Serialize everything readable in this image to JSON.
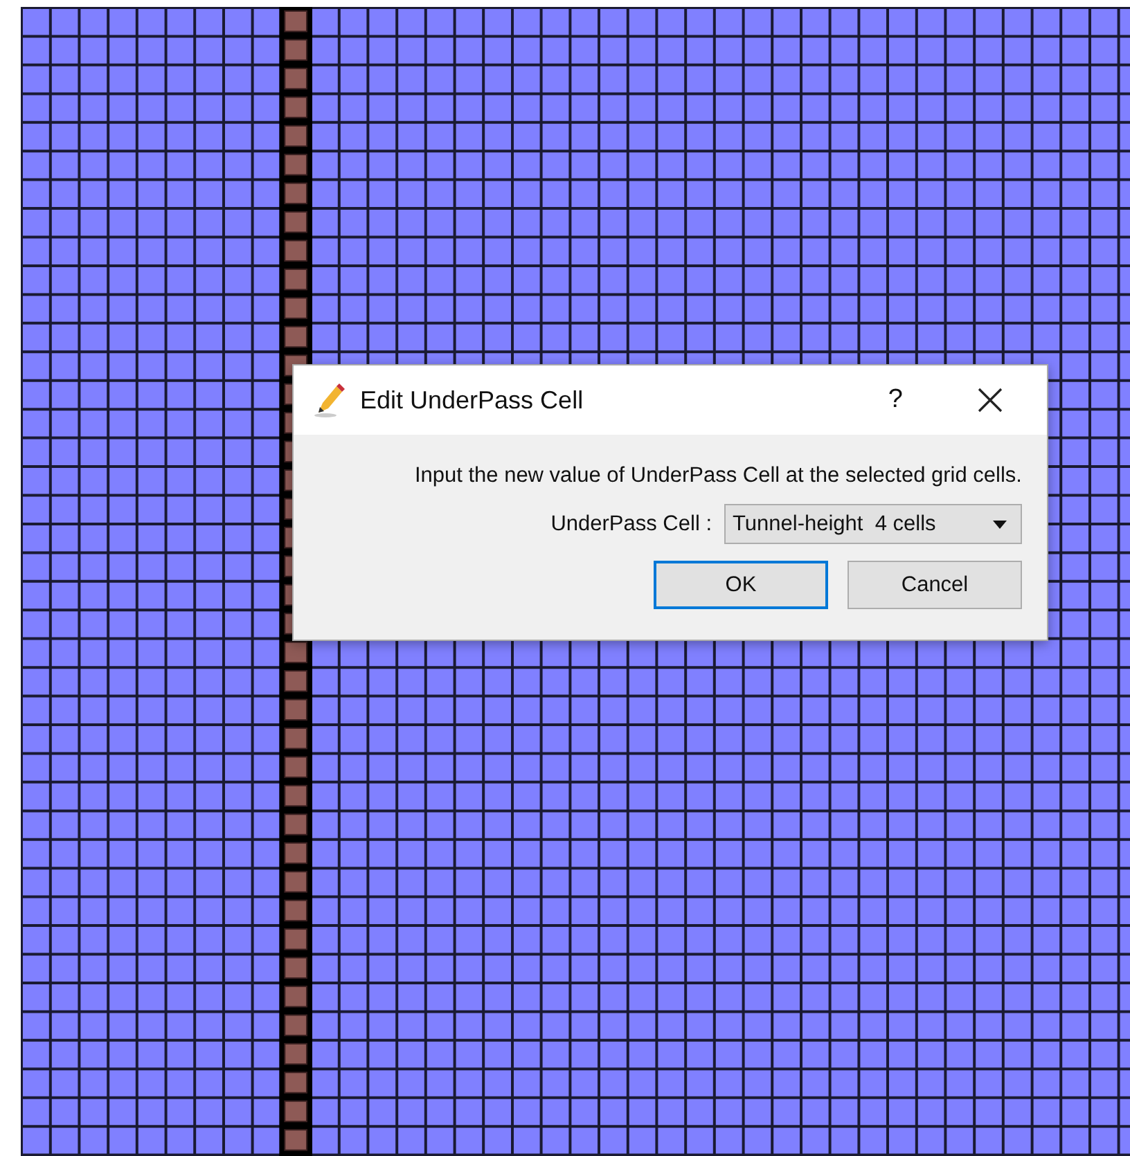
{
  "dialog": {
    "title": "Edit UnderPass Cell",
    "help": "?",
    "message": "Input the new value of UnderPass Cell at the selected grid cells.",
    "field": {
      "label": "UnderPass Cell :",
      "value": "Tunnel-height  4 cells"
    },
    "buttons": [
      {
        "label": "OK",
        "default": true
      },
      {
        "label": "Cancel",
        "default": false
      }
    ]
  }
}
